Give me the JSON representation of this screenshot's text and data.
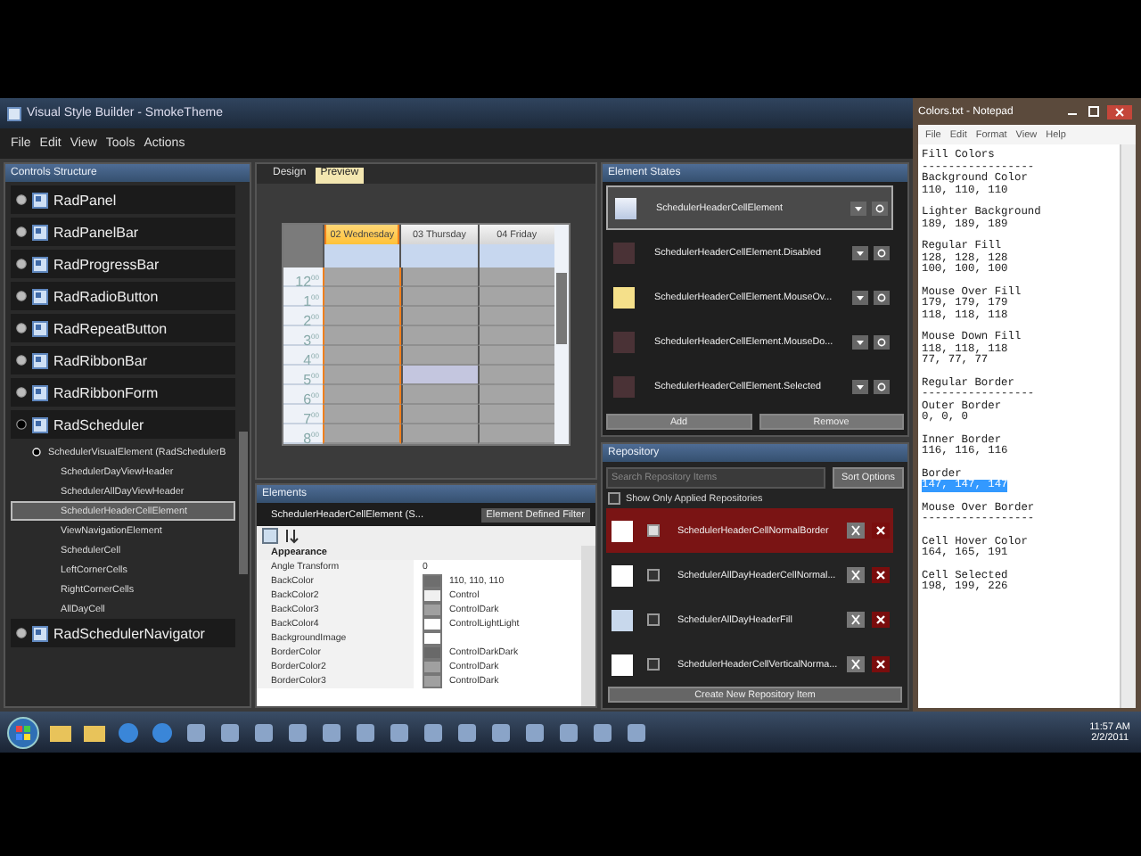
{
  "window": {
    "title": "Visual Style Builder - SmokeTheme"
  },
  "menu": [
    "File",
    "Edit",
    "View",
    "Tools",
    "Actions"
  ],
  "controls_structure": {
    "title": "Controls Structure",
    "items": [
      {
        "label": "RadPanel",
        "expanded": false,
        "selected": false
      },
      {
        "label": "RadPanelBar",
        "expanded": false,
        "selected": false
      },
      {
        "label": "RadProgressBar",
        "expanded": false,
        "selected": false
      },
      {
        "label": "RadRadioButton",
        "expanded": false,
        "selected": false
      },
      {
        "label": "RadRepeatButton",
        "expanded": false,
        "selected": false
      },
      {
        "label": "RadRibbonBar",
        "expanded": false,
        "selected": false
      },
      {
        "label": "RadRibbonForm",
        "expanded": false,
        "selected": false
      },
      {
        "label": "RadScheduler",
        "expanded": true,
        "selected": false,
        "children": [
          {
            "label": "SchedulerVisualElement (RadSchedulerB",
            "expanded": true,
            "selected": false,
            "children": [
              {
                "label": "SchedulerDayViewHeader",
                "selected": false
              },
              {
                "label": "SchedulerAllDayViewHeader",
                "selected": false
              },
              {
                "label": "SchedulerHeaderCellElement",
                "selected": true
              },
              {
                "label": "ViewNavigationElement",
                "selected": false
              },
              {
                "label": "SchedulerCell",
                "selected": false
              },
              {
                "label": "LeftCornerCells",
                "selected": false
              },
              {
                "label": "RightCornerCells",
                "selected": false
              },
              {
                "label": "AllDayCell",
                "selected": false
              }
            ]
          }
        ]
      },
      {
        "label": "RadSchedulerNavigator",
        "expanded": false,
        "selected": false
      }
    ]
  },
  "preview": {
    "tabs": [
      {
        "label": "Design",
        "selected": false
      },
      {
        "label": "Preview",
        "selected": true
      }
    ],
    "days": [
      {
        "label": "02 Wednesday",
        "selected": true
      },
      {
        "label": "03 Thursday",
        "selected": false
      },
      {
        "label": "04 Friday",
        "selected": false
      }
    ],
    "hours": [
      {
        "label": "12$^{00}$",
        "hover": [
          false,
          false,
          false
        ]
      },
      {
        "label": "1$^{00}$",
        "hover": [
          false,
          false,
          false
        ]
      },
      {
        "label": "2$^{00}$",
        "hover": [
          false,
          false,
          false
        ]
      },
      {
        "label": "3$^{00}$",
        "hover": [
          false,
          false,
          false
        ]
      },
      {
        "label": "4$^{00}$",
        "hover": [
          false,
          false,
          false
        ]
      },
      {
        "label": "5$^{00}$",
        "hover": [
          false,
          true,
          false
        ]
      },
      {
        "label": "6$^{00}$",
        "hover": [
          false,
          false,
          false
        ]
      },
      {
        "label": "7$^{00}$",
        "hover": [
          false,
          false,
          false
        ]
      },
      {
        "label": "8$^{00}$",
        "hover": [
          false,
          false,
          false
        ]
      }
    ]
  },
  "elements": {
    "title": "Elements",
    "element": "SchedulerHeaderCellElement  (S...",
    "filter": "Element Defined Filter",
    "category": "Appearance",
    "properties": [
      {
        "name": "Angle Transform",
        "value": "0"
      },
      {
        "name": "BackColor",
        "value": "110, 110, 110",
        "color": "#6e6e6e"
      },
      {
        "name": "BackColor2",
        "value": "Control",
        "color": "#f0f0f0"
      },
      {
        "name": "BackColor3",
        "value": "ControlDark",
        "color": "#a0a0a0"
      },
      {
        "name": "BackColor4",
        "value": "ControlLightLight",
        "color": "#ffffff"
      },
      {
        "name": "BackgroundImage",
        "color": "#ffffff"
      },
      {
        "name": "BorderColor",
        "value": "ControlDarkDark",
        "color": "#696969"
      },
      {
        "name": "BorderColor2",
        "value": "ControlDark",
        "color": "#a0a0a0"
      },
      {
        "name": "BorderColor3",
        "value": "ControlDark",
        "color": "#a0a0a0"
      }
    ]
  },
  "element_states": {
    "title": "Element States",
    "items": [
      {
        "label": "SchedulerHeaderCellElement",
        "selected": true,
        "kind": "normal"
      },
      {
        "label": "SchedulerHeaderCellElement.Disabled",
        "selected": false,
        "kind": "plain"
      },
      {
        "label": "SchedulerHeaderCellElement.MouseOv...",
        "selected": false,
        "kind": "hover"
      },
      {
        "label": "SchedulerHeaderCellElement.MouseDo...",
        "selected": false,
        "kind": "plain"
      },
      {
        "label": "SchedulerHeaderCellElement.Selected",
        "selected": false,
        "kind": "plain"
      }
    ],
    "buttons": [
      "Add",
      "Remove"
    ]
  },
  "repository": {
    "title": "Repository",
    "search": {
      "placeholder": "Search Repository Items"
    },
    "sort": "Sort Options",
    "filter": {
      "label": "Show Only Applied Repositories",
      "checked": false
    },
    "items": [
      {
        "label": "SchedulerHeaderCellNormalBorder",
        "selected": true,
        "checked": true,
        "color": "#ffffff"
      },
      {
        "label": "SchedulerAllDayHeaderCellNormal...",
        "selected": false,
        "checked": false,
        "color": "#ffffff"
      },
      {
        "label": "SchedulerAllDayHeaderFill",
        "selected": false,
        "checked": false,
        "color": "#c8d8ec"
      },
      {
        "label": "SchedulerHeaderCellVerticalNorma...",
        "selected": false,
        "checked": false,
        "color": "#ffffff"
      }
    ],
    "create": "Create New Repository Item"
  },
  "notepad": {
    "title": "Colors.txt - Notepad",
    "menu": [
      "File",
      "Edit",
      "Format",
      "View",
      "Help"
    ],
    "blocks": [
      [
        {
          "text": "Fill Colors",
          "selected": false
        },
        {
          "text": "-----------------",
          "selected": false
        },
        {
          "text": "Background Color",
          "selected": false
        },
        {
          "text": "110, 110, 110",
          "selected": false
        }
      ],
      [
        {
          "text": "Lighter Background",
          "selected": false
        },
        {
          "text": "189, 189, 189",
          "selected": false
        }
      ],
      [
        {
          "text": "Regular Fill",
          "selected": false
        },
        {
          "text": "128, 128, 128",
          "selected": false
        },
        {
          "text": "100, 100, 100",
          "selected": false
        }
      ],
      [
        {
          "text": "Mouse Over Fill",
          "selected": false
        },
        {
          "text": "179, 179, 179",
          "selected": false
        },
        {
          "text": "118, 118, 118",
          "selected": false
        }
      ],
      [
        {
          "text": "Mouse Down Fill",
          "selected": false
        },
        {
          "text": "118, 118, 118",
          "selected": false
        },
        {
          "text": "77, 77, 77",
          "selected": false
        }
      ],
      [
        {
          "text": "Regular Border",
          "selected": false
        },
        {
          "text": "-----------------",
          "selected": false
        },
        {
          "text": "Outer Border",
          "selected": false
        },
        {
          "text": "0, 0, 0",
          "selected": false
        }
      ],
      [
        {
          "text": "Inner Border",
          "selected": false
        },
        {
          "text": "116, 116, 116",
          "selected": false
        }
      ],
      [
        {
          "text": "Border",
          "selected": false
        },
        {
          "text": "147, 147, 147",
          "selected": true
        }
      ],
      [
        {
          "text": "Mouse Over Border",
          "selected": false
        },
        {
          "text": "-----------------",
          "selected": false
        }
      ],
      [
        {
          "text": "Cell Hover Color",
          "selected": false
        },
        {
          "text": "164, 165, 191",
          "selected": false
        }
      ],
      [
        {
          "text": "Cell Selected",
          "selected": false
        },
        {
          "text": "198, 199, 226",
          "selected": false
        }
      ]
    ]
  },
  "taskbar": {
    "time": "11:57 AM",
    "date": "2/2/2011"
  }
}
